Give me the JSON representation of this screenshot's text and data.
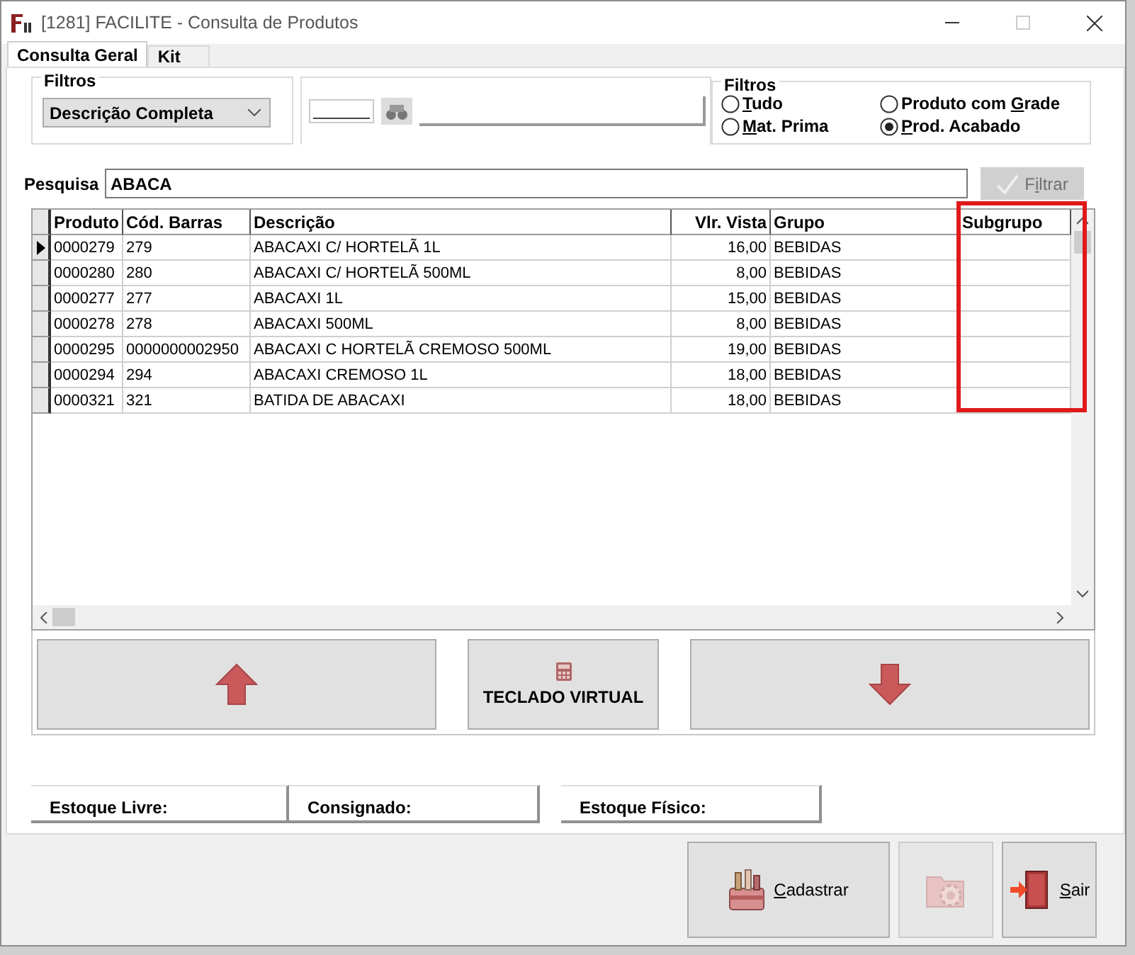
{
  "window": {
    "title": "[1281] FACILITE - Consulta de Produtos"
  },
  "tabs": [
    {
      "label": "Consulta Geral",
      "selected": true
    },
    {
      "label": "Kit",
      "selected": false
    }
  ],
  "filter_type": {
    "title": "Filtros",
    "dropdown": {
      "value": "Descrição Completa"
    }
  },
  "product_filter": {
    "title": "Filtros",
    "options": [
      {
        "label": {
          "key": "T",
          "post": "udo"
        },
        "selected": false
      },
      {
        "label": {
          "pre": "Produto com ",
          "key": "G",
          "post": "rade"
        },
        "selected": false
      },
      {
        "label": {
          "key": "M",
          "post": "at. Prima"
        },
        "selected": false
      },
      {
        "label": {
          "key": "P",
          "post": "rod. Acabado"
        },
        "selected": true
      }
    ]
  },
  "search": {
    "label": "Pesquisa",
    "value": "ABACA"
  },
  "filter_button": {
    "label": {
      "pre": "F",
      "key": "i",
      "post": "ltrar"
    },
    "disabled": true
  },
  "grid": {
    "columns": [
      {
        "label": "Produto",
        "highlighted": false
      },
      {
        "label": "Cód. Barras",
        "highlighted": false
      },
      {
        "label": "Descrição",
        "highlighted": false
      },
      {
        "label": "Vlr. Vista",
        "highlighted": false
      },
      {
        "label": "Grupo",
        "highlighted": false
      },
      {
        "label": "Subgrupo",
        "highlighted": true
      }
    ],
    "rows": [
      {
        "selected": true,
        "cells": [
          "0000279",
          "279",
          "ABACAXI  C/ HORTELÃ 1L",
          "16,00",
          "BEBIDAS",
          ""
        ]
      },
      {
        "selected": false,
        "cells": [
          "0000280",
          "280",
          "ABACAXI  C/ HORTELÃ 500ML",
          "8,00",
          "BEBIDAS",
          ""
        ]
      },
      {
        "selected": false,
        "cells": [
          "0000277",
          "277",
          "ABACAXI 1L",
          "15,00",
          "BEBIDAS",
          ""
        ]
      },
      {
        "selected": false,
        "cells": [
          "0000278",
          "278",
          "ABACAXI 500ML",
          "8,00",
          "BEBIDAS",
          ""
        ]
      },
      {
        "selected": false,
        "cells": [
          "0000295",
          "0000000002950",
          "ABACAXI C HORTELÃ CREMOSO 500ML",
          "19,00",
          "BEBIDAS",
          ""
        ]
      },
      {
        "selected": false,
        "cells": [
          "0000294",
          "294",
          "ABACAXI CREMOSO 1L",
          "18,00",
          "BEBIDAS",
          ""
        ]
      },
      {
        "selected": false,
        "cells": [
          "0000321",
          "321",
          "BATIDA DE ABACAXI",
          "18,00",
          "BEBIDAS",
          ""
        ]
      }
    ]
  },
  "nav_buttons": [
    {
      "kind": "up"
    },
    {
      "kind": "keyboard",
      "label": "TECLADO VIRTUAL"
    },
    {
      "kind": "down"
    }
  ],
  "stock_fields": [
    {
      "label": "Estoque Livre:"
    },
    {
      "label": "Consignado:"
    },
    {
      "label": "Estoque Físico:"
    }
  ],
  "actions": [
    {
      "kind": "register",
      "label": {
        "key": "C",
        "post": "adastrar"
      },
      "disabled": false
    },
    {
      "kind": "settings",
      "disabled": true
    },
    {
      "kind": "exit",
      "label": {
        "key": "S",
        "post": "air"
      },
      "disabled": false
    }
  ]
}
